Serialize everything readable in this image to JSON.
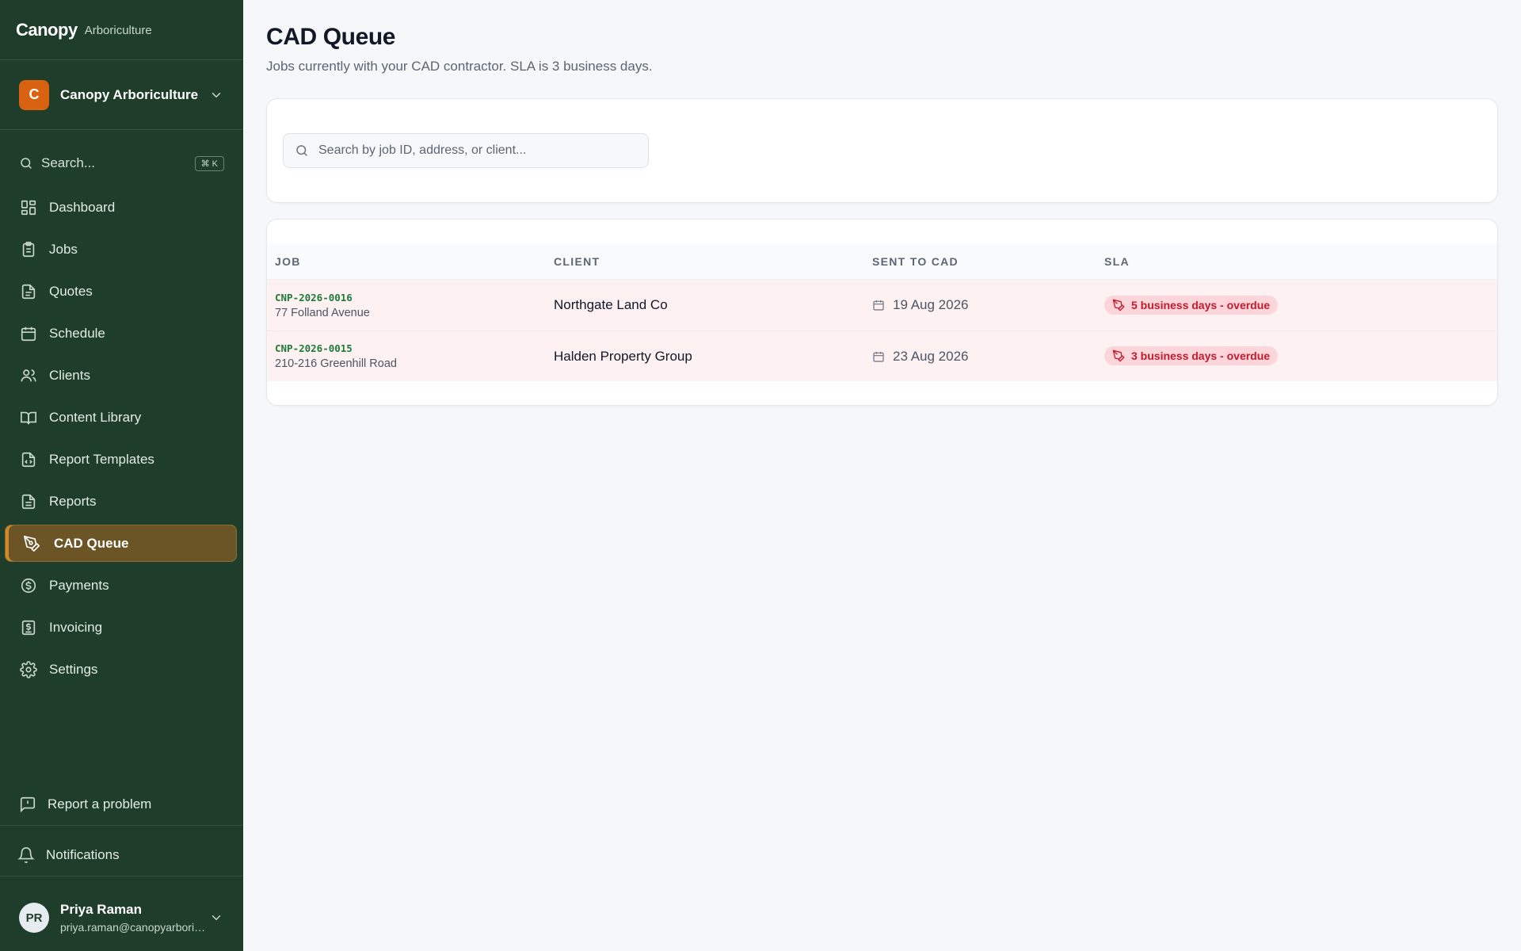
{
  "brand": {
    "name": "Canopy",
    "subtitle": "Arboriculture"
  },
  "org": {
    "initial": "C",
    "name": "Canopy Arboriculture"
  },
  "sidebar": {
    "search_label": "Search...",
    "search_shortcut": "⌘ K",
    "items": [
      {
        "label": "Dashboard",
        "icon": "dashboard-icon"
      },
      {
        "label": "Jobs",
        "icon": "clipboard-icon"
      },
      {
        "label": "Quotes",
        "icon": "document-icon"
      },
      {
        "label": "Schedule",
        "icon": "calendar-icon"
      },
      {
        "label": "Clients",
        "icon": "users-icon"
      },
      {
        "label": "Content Library",
        "icon": "book-icon"
      },
      {
        "label": "Report Templates",
        "icon": "file-code-icon"
      },
      {
        "label": "Reports",
        "icon": "file-text-icon"
      },
      {
        "label": "CAD Queue",
        "icon": "pen-tool-icon",
        "active": true
      },
      {
        "label": "Payments",
        "icon": "dollar-circle-icon"
      },
      {
        "label": "Invoicing",
        "icon": "receipt-icon"
      },
      {
        "label": "Settings",
        "icon": "gear-icon"
      }
    ],
    "report_problem": "Report a problem",
    "notifications": "Notifications"
  },
  "user": {
    "initials": "PR",
    "name": "Priya Raman",
    "email": "priya.raman@canopyarboriculture.com"
  },
  "page": {
    "title": "CAD Queue",
    "subtitle": "Jobs currently with your CAD contractor. SLA is 3 business days.",
    "search_placeholder": "Search by job ID, address, or client..."
  },
  "table": {
    "headers": {
      "job": "Job",
      "client": "Client",
      "sent": "Sent to CAD",
      "sla": "SLA"
    },
    "rows": [
      {
        "job_id": "CNP-2026-0016",
        "address": "77 Folland Avenue",
        "client": "Northgate Land Co",
        "sent": "19 Aug 2026",
        "sla": "5 business days - overdue"
      },
      {
        "job_id": "CNP-2026-0015",
        "address": "210-216 Greenhill Road",
        "client": "Halden Property Group",
        "sent": "23 Aug 2026",
        "sla": "3 business days - overdue"
      }
    ]
  },
  "colors": {
    "sidebar_bg": "#1f3d2b",
    "active_bg": "#6b5527",
    "org_badge": "#d8620f",
    "overdue_text": "#c21a2e",
    "overdue_bg": "#fbd5d9",
    "row_bg": "#fdf1f2",
    "job_id": "#1f7a3a"
  }
}
